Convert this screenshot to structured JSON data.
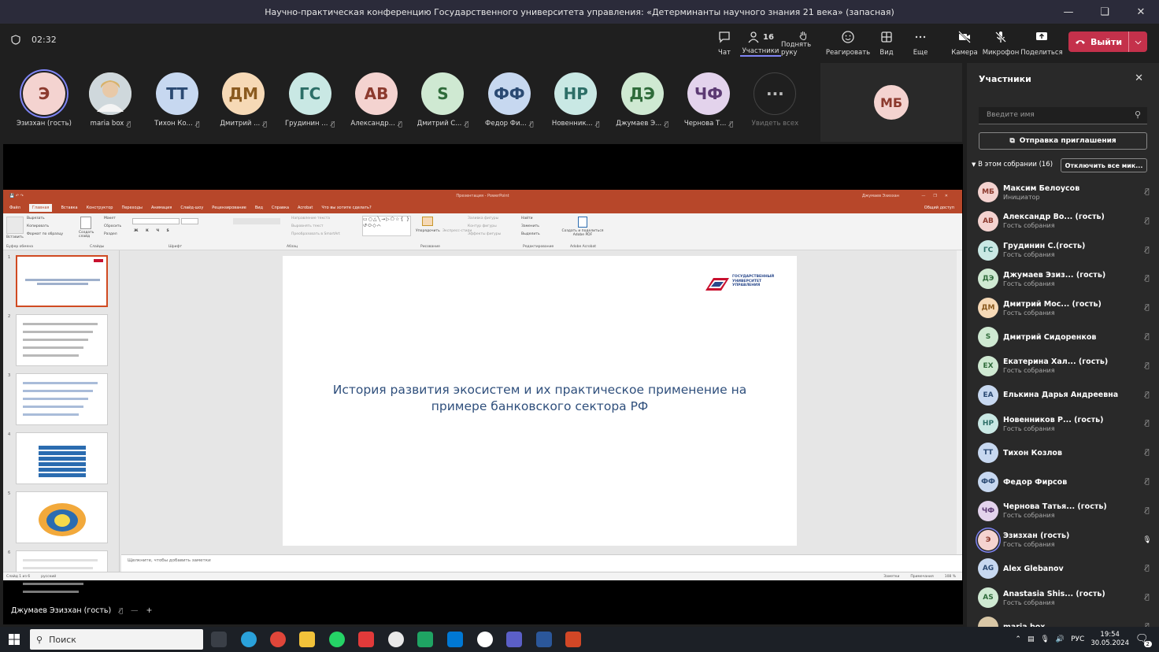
{
  "window": {
    "title": "Научно-практическая конференцию Государственного университета управления: «Детерминанты научного знания 21 века» (запасная)"
  },
  "toolbar": {
    "timer": "02:32",
    "chat": "Чат",
    "participants": "Участники",
    "participants_count": "16",
    "raise_hand": "Поднять руку",
    "react": "Реагировать",
    "view": "Вид",
    "more": "Еще",
    "camera": "Камера",
    "mic": "Микрофон",
    "share": "Поделиться",
    "leave": "Выйти"
  },
  "strip": [
    {
      "initials": "Э",
      "name": "Эзизхан (гость)",
      "bg": "#f4d3d0",
      "fg": "#8c3a2e",
      "ring": true,
      "mic": false
    },
    {
      "initials": "",
      "name": "maria box",
      "bg": "#d9c7a6",
      "fg": "#5a4a2e",
      "photo": true,
      "mic": true
    },
    {
      "initials": "ТТ",
      "name": "Тихон Ко...",
      "bg": "#c7d8f0",
      "fg": "#2b4a73",
      "mic": true
    },
    {
      "initials": "ДМ",
      "name": "Дмитрий ...",
      "bg": "#f6d9b6",
      "fg": "#8a5a1f",
      "mic": true
    },
    {
      "initials": "ГС",
      "name": "Грудинин ...",
      "bg": "#c9e8e4",
      "fg": "#2c6e67",
      "mic": true
    },
    {
      "initials": "АВ",
      "name": "Александр...",
      "bg": "#f4d3d0",
      "fg": "#8c3a2e",
      "mic": true
    },
    {
      "initials": "S",
      "name": "Дмитрий С...",
      "bg": "#cfe9d2",
      "fg": "#2f6b3a",
      "mic": true
    },
    {
      "initials": "ФФ",
      "name": "Федор Фи...",
      "bg": "#c7d8f0",
      "fg": "#2b4a73",
      "mic": true
    },
    {
      "initials": "НР",
      "name": "Новенник...",
      "bg": "#c9e8e4",
      "fg": "#2c6e67",
      "mic": true
    },
    {
      "initials": "ДЭ",
      "name": "Джумаев Э...",
      "bg": "#cfe9d2",
      "fg": "#2f6b3a",
      "mic": true
    },
    {
      "initials": "ЧФ",
      "name": "Чернова Т...",
      "bg": "#e3d3ec",
      "fg": "#5c3a73",
      "mic": true
    },
    {
      "initials": "···",
      "name": "Увидеть всех",
      "bg": "#1f1f1f",
      "fg": "#bbb",
      "mic": false
    }
  ],
  "spotlight": {
    "initials": "МБ"
  },
  "ppt": {
    "title": "Презентация - PowerPoint",
    "user": "Джумаев Эзизхан",
    "tabs": [
      "Файл",
      "Главная",
      "Вставка",
      "Конструктор",
      "Переходы",
      "Анимация",
      "Слайд-шоу",
      "Рецензирование",
      "Вид",
      "Справка",
      "Acrobat",
      "Что вы хотите сделать?"
    ],
    "share_btn": "Общий доступ",
    "groups": [
      "Буфер обмена",
      "Слайды",
      "Шрифт",
      "Абзац",
      "Рисование",
      "Редактирование",
      "Adobe Acrobat"
    ],
    "ribbon": {
      "paste": "Вставить",
      "cut": "Вырезать",
      "copy": "Копировать",
      "format_painter": "Формат по образцу",
      "new_slide": "Создать слайд",
      "layout": "Макет",
      "reset": "Сбросить",
      "section": "Раздел",
      "text_direction": "Направление текста",
      "align_text": "Выровнять текст",
      "smartart": "Преобразовать в SmartArt",
      "arrange": "Упорядочить",
      "quick_styles": "Экспресс-стили",
      "shape_fill": "Заливка фигуры",
      "shape_outline": "Контур фигуры",
      "shape_effects": "Эффекты фигуры",
      "find": "Найти",
      "replace": "Заменить",
      "select": "Выделить",
      "acrobat": "Создать и поделиться Adobe PDF"
    },
    "slide_title": "История развития экосистем и их практическое применение на примере банковского сектора РФ",
    "logo_text": "ГОСУДАРСТВЕННЫЙ УНИВЕРСИТЕТ УПРАВЛЕНИЯ",
    "thumb_numbers": [
      "1",
      "2",
      "3",
      "4",
      "5",
      "6"
    ],
    "notes": "Щелкните, чтобы добавить заметки",
    "status_slide": "Слайд 1 из 6",
    "status_lang": "русский",
    "status_notes": "Заметки",
    "status_comments": "Примечания",
    "zoom": "108 %"
  },
  "presenter": "Джумаев Эзизхан (гость)",
  "panel": {
    "title": "Участники",
    "search_placeholder": "Введите имя",
    "invite": "Отправка приглашения",
    "section": "В этом собрании (16)",
    "mute_all": "Отключить все мик...",
    "people": [
      {
        "initials": "МБ",
        "name": "Максим Белоусов",
        "role": "Инициатор",
        "bg": "#f4d3d0",
        "fg": "#8c3a2e",
        "mic": "off"
      },
      {
        "initials": "АВ",
        "name": "Александр Во... (гость)",
        "role": "Гость собрания",
        "bg": "#f4d3d0",
        "fg": "#8c3a2e",
        "mic": "off"
      },
      {
        "initials": "ГС",
        "name": "Грудинин С.(гость)",
        "role": "Гость собрания",
        "bg": "#c9e8e4",
        "fg": "#2c6e67",
        "mic": "off"
      },
      {
        "initials": "ДЭ",
        "name": "Джумаев Эзиз... (гость)",
        "role": "Гость собрания",
        "bg": "#cfe9d2",
        "fg": "#2f6b3a",
        "mic": "off"
      },
      {
        "initials": "ДМ",
        "name": "Дмитрий Мос... (гость)",
        "role": "Гость собрания",
        "bg": "#f6d9b6",
        "fg": "#8a5a1f",
        "mic": "off"
      },
      {
        "initials": "S",
        "name": "Дмитрий Сидоренков",
        "role": "",
        "bg": "#cfe9d2",
        "fg": "#2f6b3a",
        "mic": "off"
      },
      {
        "initials": "ЕХ",
        "name": "Екатерина Хал... (гость)",
        "role": "Гость собрания",
        "bg": "#cfe9d2",
        "fg": "#2f6b3a",
        "mic": "off"
      },
      {
        "initials": "ЕА",
        "name": "Елькина Дарья Андреевна",
        "role": "",
        "bg": "#c7d8f0",
        "fg": "#2b4a73",
        "mic": "off"
      },
      {
        "initials": "НР",
        "name": "Новенников Р... (гость)",
        "role": "Гость собрания",
        "bg": "#c9e8e4",
        "fg": "#2c6e67",
        "mic": "off"
      },
      {
        "initials": "ТТ",
        "name": "Тихон Козлов",
        "role": "",
        "bg": "#c7d8f0",
        "fg": "#2b4a73",
        "mic": "off"
      },
      {
        "initials": "ФФ",
        "name": "Федор Фирсов",
        "role": "",
        "bg": "#c7d8f0",
        "fg": "#2b4a73",
        "mic": "off"
      },
      {
        "initials": "ЧФ",
        "name": "Чернова Татья... (гость)",
        "role": "Гость собрания",
        "bg": "#e3d3ec",
        "fg": "#5c3a73",
        "mic": "off"
      },
      {
        "initials": "Э",
        "name": "Эзизхан (гость)",
        "role": "Гость собрания",
        "bg": "#f4d3d0",
        "fg": "#8c3a2e",
        "mic": "on",
        "ring": true
      },
      {
        "initials": "AG",
        "name": "Alex Glebanov",
        "role": "",
        "bg": "#c7d8f0",
        "fg": "#2b4a73",
        "mic": "off"
      },
      {
        "initials": "AS",
        "name": "Anastasia Shis... (гость)",
        "role": "Гость собрания",
        "bg": "#cfe9d2",
        "fg": "#2f6b3a",
        "mic": "off"
      },
      {
        "initials": "",
        "name": "maria box",
        "role": "",
        "bg": "#d9c7a6",
        "fg": "#5a4a2e",
        "mic": "off"
      }
    ]
  },
  "taskbar": {
    "search": "Поиск",
    "lang": "РУС",
    "time": "19:54",
    "date": "30.05.2024",
    "notifications": "2"
  }
}
